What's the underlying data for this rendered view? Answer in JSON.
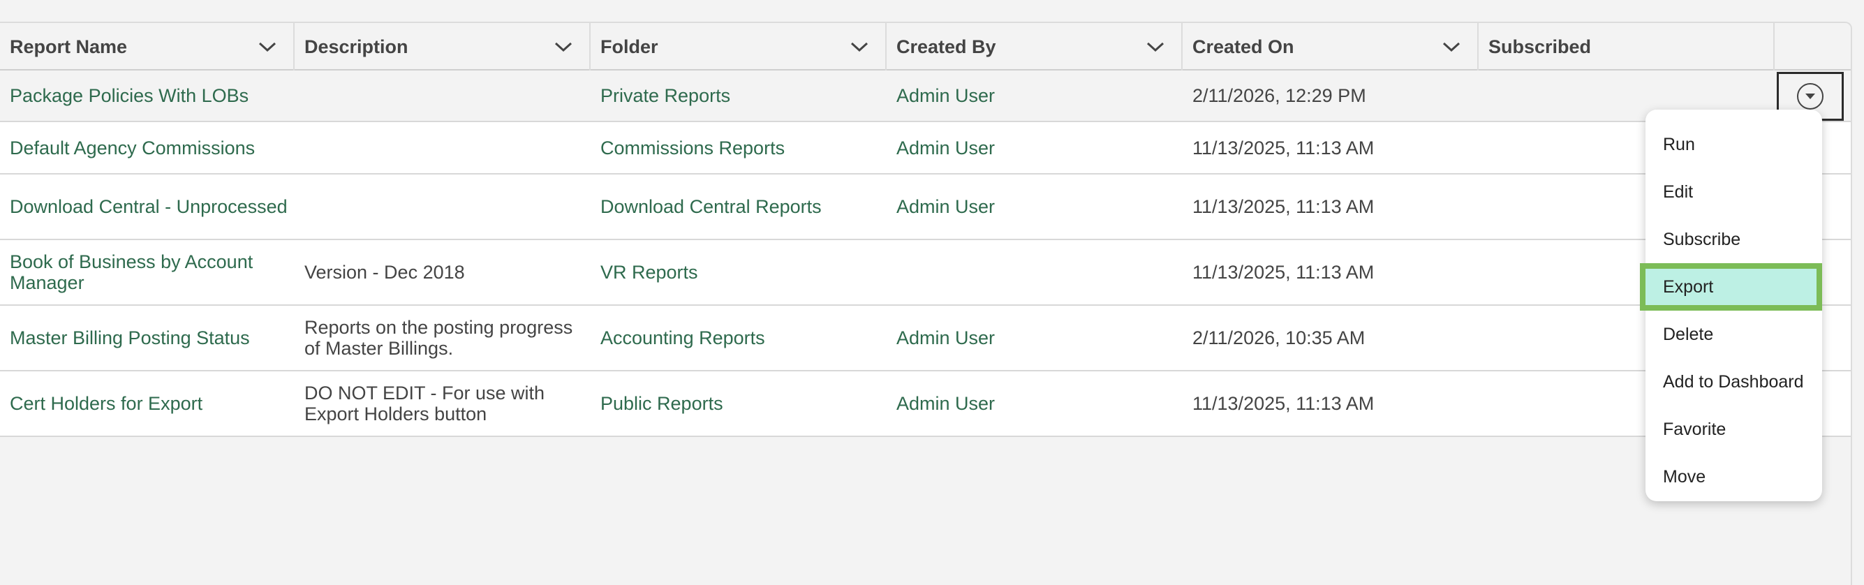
{
  "columns": [
    {
      "label": "Report Name",
      "sortable": true
    },
    {
      "label": "Description",
      "sortable": true
    },
    {
      "label": "Folder",
      "sortable": true
    },
    {
      "label": "Created By",
      "sortable": true
    },
    {
      "label": "Created On",
      "sortable": true
    },
    {
      "label": "Subscribed",
      "sortable": false
    }
  ],
  "rows": [
    {
      "name": "Package Policies With LOBs",
      "description": "",
      "folder": "Private Reports",
      "created_by": "Admin User",
      "created_on": "2/11/2026, 12:29 PM",
      "subscribed": ""
    },
    {
      "name": "Default Agency Commissions",
      "description": "",
      "folder": "Commissions Reports",
      "created_by": "Admin User",
      "created_on": "11/13/2025, 11:13 AM",
      "subscribed": ""
    },
    {
      "name": "Download Central - Unprocessed",
      "description": "",
      "folder": "Download Central Reports",
      "created_by": "Admin User",
      "created_on": "11/13/2025, 11:13 AM",
      "subscribed": ""
    },
    {
      "name": "Book of Business by Account Manager",
      "description": "Version - Dec 2018",
      "folder": "VR Reports",
      "created_by": "",
      "created_on": "11/13/2025, 11:13 AM",
      "subscribed": ""
    },
    {
      "name": "Master Billing Posting Status",
      "description": "Reports on the posting progress of Master Billings.",
      "folder": "Accounting Reports",
      "created_by": "Admin User",
      "created_on": "2/11/2026, 10:35 AM",
      "subscribed": ""
    },
    {
      "name": "Cert Holders for Export",
      "description": "DO NOT EDIT - For use with Export Holders button",
      "folder": "Public Reports",
      "created_by": "Admin User",
      "created_on": "11/13/2025, 11:13 AM",
      "subscribed": ""
    }
  ],
  "action_menu": {
    "items": [
      "Run",
      "Edit",
      "Subscribe",
      "Export",
      "Delete",
      "Add to Dashboard",
      "Favorite",
      "Move"
    ],
    "highlighted": "Export"
  },
  "colors": {
    "link": "#2e6a4d",
    "highlight_fill": "#bdf0e4",
    "highlight_border": "#7cbc57"
  }
}
